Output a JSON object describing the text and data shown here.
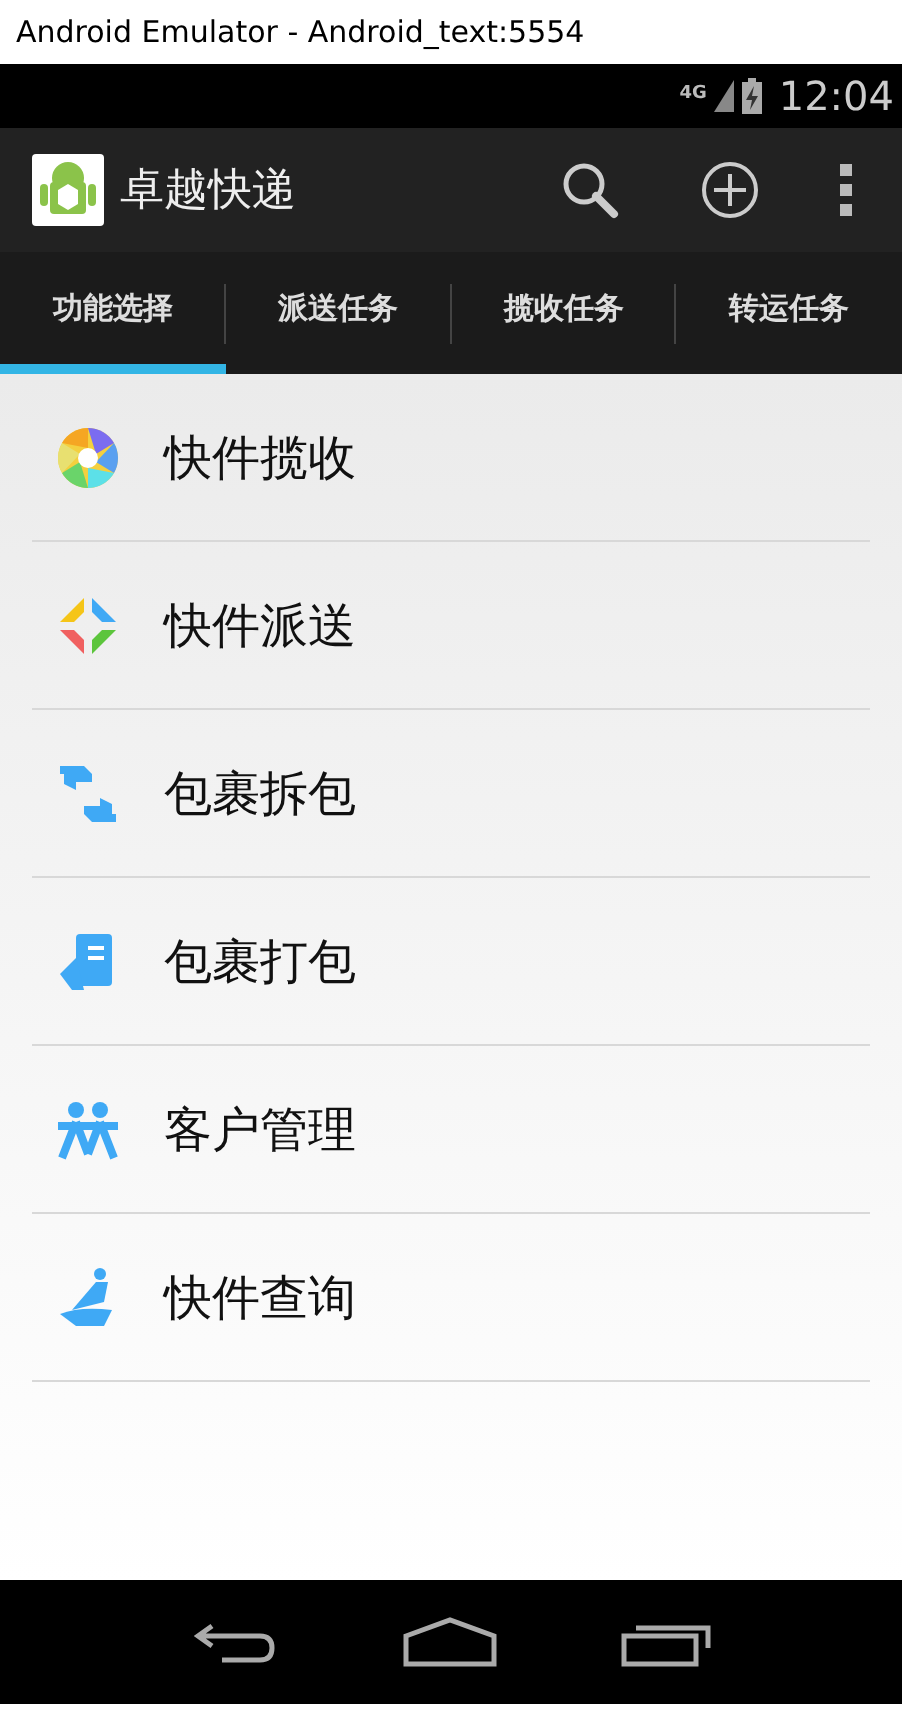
{
  "window": {
    "title": "Android Emulator - Android_text:5554"
  },
  "status_bar": {
    "network": "4G",
    "time": "12:04"
  },
  "action_bar": {
    "title": "卓越快递"
  },
  "tabs": [
    {
      "label": "功能选择",
      "selected": true
    },
    {
      "label": "派送任务",
      "selected": false
    },
    {
      "label": "揽收任务",
      "selected": false
    },
    {
      "label": "转运任务",
      "selected": false
    }
  ],
  "menu": [
    {
      "label": "快件揽收",
      "kind": "aperture"
    },
    {
      "label": "快件派送",
      "kind": "diamond"
    },
    {
      "label": "包裹拆包",
      "kind": "swap"
    },
    {
      "label": "包裹打包",
      "kind": "pack"
    },
    {
      "label": "客户管理",
      "kind": "people"
    },
    {
      "label": "快件查询",
      "kind": "query"
    }
  ]
}
